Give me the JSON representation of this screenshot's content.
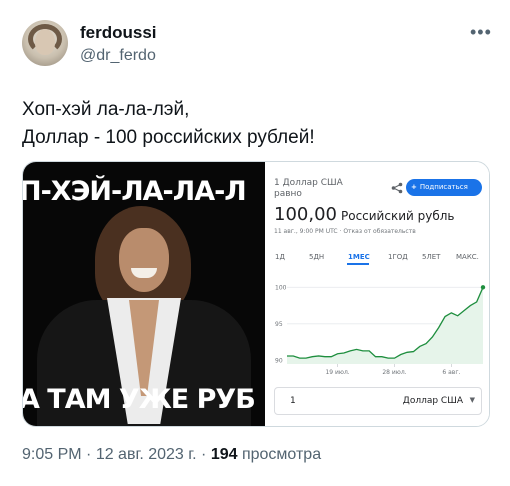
{
  "author": {
    "name": "ferdoussi",
    "handle": "@dr_ferdo",
    "more_icon": "more-dots-icon"
  },
  "tweet": {
    "lines": [
      "Хоп-хэй ла-ла-лэй,",
      "Доллар - 100 российских рублей!"
    ]
  },
  "meme": {
    "top_text": "П-ХЭЙ-ЛА-ЛА-Л",
    "bottom_text": "А ТАМ УЖЕ РУБ"
  },
  "rate_card": {
    "heading": "1 Доллар США",
    "heading_sub": "равно",
    "share_icon": "share-icon",
    "subscribe_label": "Подписаться",
    "value": "100,00",
    "unit": "Российский рубль",
    "note": "11 авг., 9:00 PM UTC · Отказ от обязательств",
    "tabs": [
      "1Д",
      "5ДН",
      "1МЕС",
      "1ГОД",
      "5ЛЕТ",
      "МАКС."
    ],
    "active_tab": "1МЕС",
    "converter": {
      "amount": "1",
      "currency": "Доллар США"
    }
  },
  "chart_data": {
    "type": "line",
    "x": [
      "11 июл.",
      "12 июл.",
      "13 июл.",
      "14 июл.",
      "15 июл.",
      "16 июл.",
      "17 июл.",
      "18 июл.",
      "19 июл.",
      "20 июл.",
      "21 июл.",
      "22 июл.",
      "23 июл.",
      "24 июл.",
      "25 июл.",
      "26 июл.",
      "27 июл.",
      "28 июл.",
      "29 июл.",
      "30 июл.",
      "31 июл.",
      "1 авг.",
      "2 авг.",
      "3 авг.",
      "4 авг.",
      "5 авг.",
      "6 авг.",
      "7 авг.",
      "8 авг.",
      "9 авг.",
      "10 авг.",
      "11 авг."
    ],
    "series": [
      {
        "values": [
          90.6,
          90.6,
          90.3,
          90.3,
          90.5,
          90.6,
          90.5,
          90.5,
          90.9,
          91.0,
          91.3,
          91.5,
          91.3,
          91.3,
          90.5,
          90.5,
          90.3,
          90.3,
          90.8,
          91.1,
          91.2,
          91.9,
          92.3,
          93.2,
          94.5,
          96.0,
          96.5,
          96.1,
          96.8,
          97.5,
          98.0,
          100.0
        ]
      }
    ],
    "x_ticks": [
      "19 июл.",
      "28 июл.",
      "6 авг."
    ],
    "y_ticks": [
      90,
      95,
      100
    ],
    "ylim": [
      89.5,
      101
    ],
    "grid": true,
    "line_color": "#1e8e3e",
    "fill_color": "#e6f4ea"
  },
  "footer": {
    "time": "9:05 PM",
    "sep1": " · ",
    "date": "12 авг. 2023 г.",
    "sep2": " · ",
    "views_count": "194",
    "views_label": " просмотра"
  }
}
